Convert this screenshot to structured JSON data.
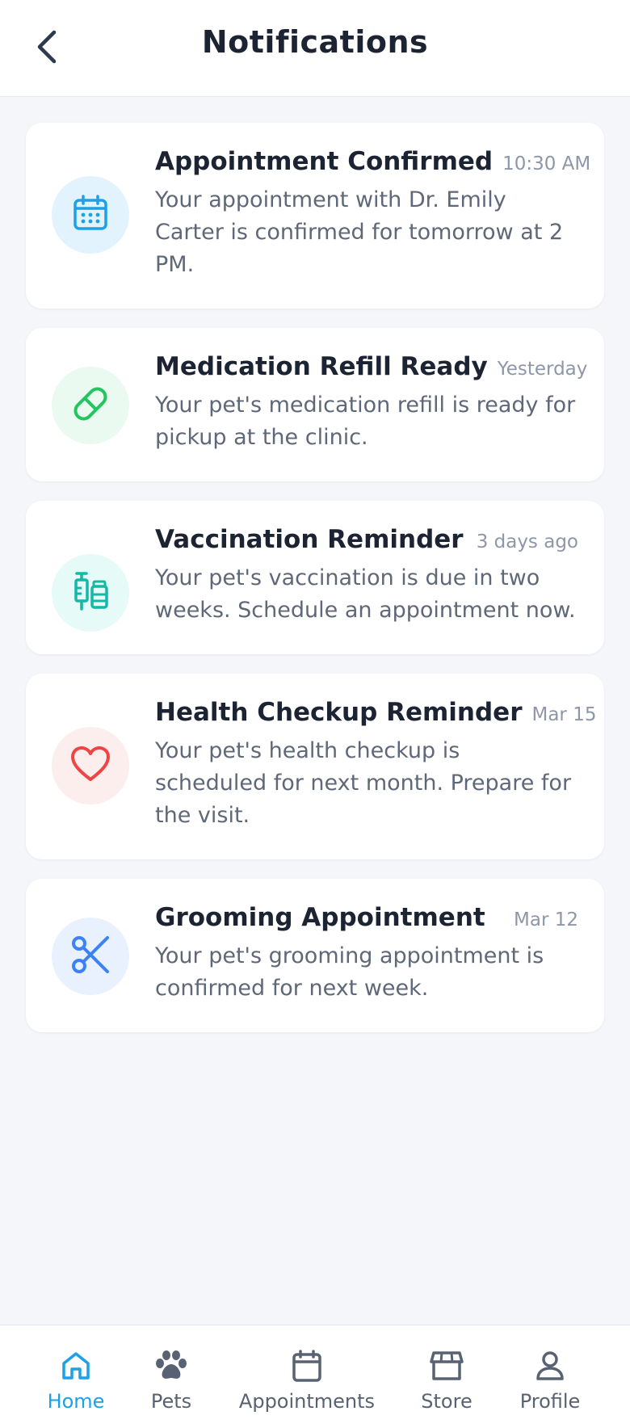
{
  "header": {
    "title": "Notifications"
  },
  "notifications": [
    {
      "title": "Appointment Confirmed",
      "time": "10:30 AM",
      "body": "Your appointment with Dr. Emily Carter is confirmed for tomorrow at 2 PM.",
      "icon": "calendar-icon",
      "color": "#1da1e6",
      "bg": "#e3f3fd"
    },
    {
      "title": "Medication Refill Ready",
      "time": "Yesterday",
      "body": "Your pet's medication refill is ready for pickup at the clinic.",
      "icon": "pill-icon",
      "color": "#22c55e",
      "bg": "#eafaf0"
    },
    {
      "title": "Vaccination Reminder",
      "time": "3 days ago",
      "body": "Your pet's vaccination is due in two weeks. Schedule an appointment now.",
      "icon": "syringe-icon",
      "color": "#14b8a6",
      "bg": "#e6faf8"
    },
    {
      "title": "Health Checkup Reminder",
      "time": "Mar 15",
      "body": "Your pet's health checkup is scheduled for next month. Prepare for the visit.",
      "icon": "heart-icon",
      "color": "#ef4444",
      "bg": "#fdeeee"
    },
    {
      "title": "Grooming Appointment",
      "time": "Mar 12",
      "body": "Your pet's grooming appointment is confirmed for next week.",
      "icon": "scissors-icon",
      "color": "#3b82f6",
      "bg": "#e9f1fe"
    }
  ],
  "nav": {
    "active_color": "#1da1e6",
    "items": [
      {
        "label": "Home",
        "icon": "home-icon",
        "active": true
      },
      {
        "label": "Pets",
        "icon": "paw-icon",
        "active": false
      },
      {
        "label": "Appointments",
        "icon": "calendar-icon",
        "active": false
      },
      {
        "label": "Store",
        "icon": "store-icon",
        "active": false
      },
      {
        "label": "Profile",
        "icon": "user-icon",
        "active": false
      }
    ]
  }
}
